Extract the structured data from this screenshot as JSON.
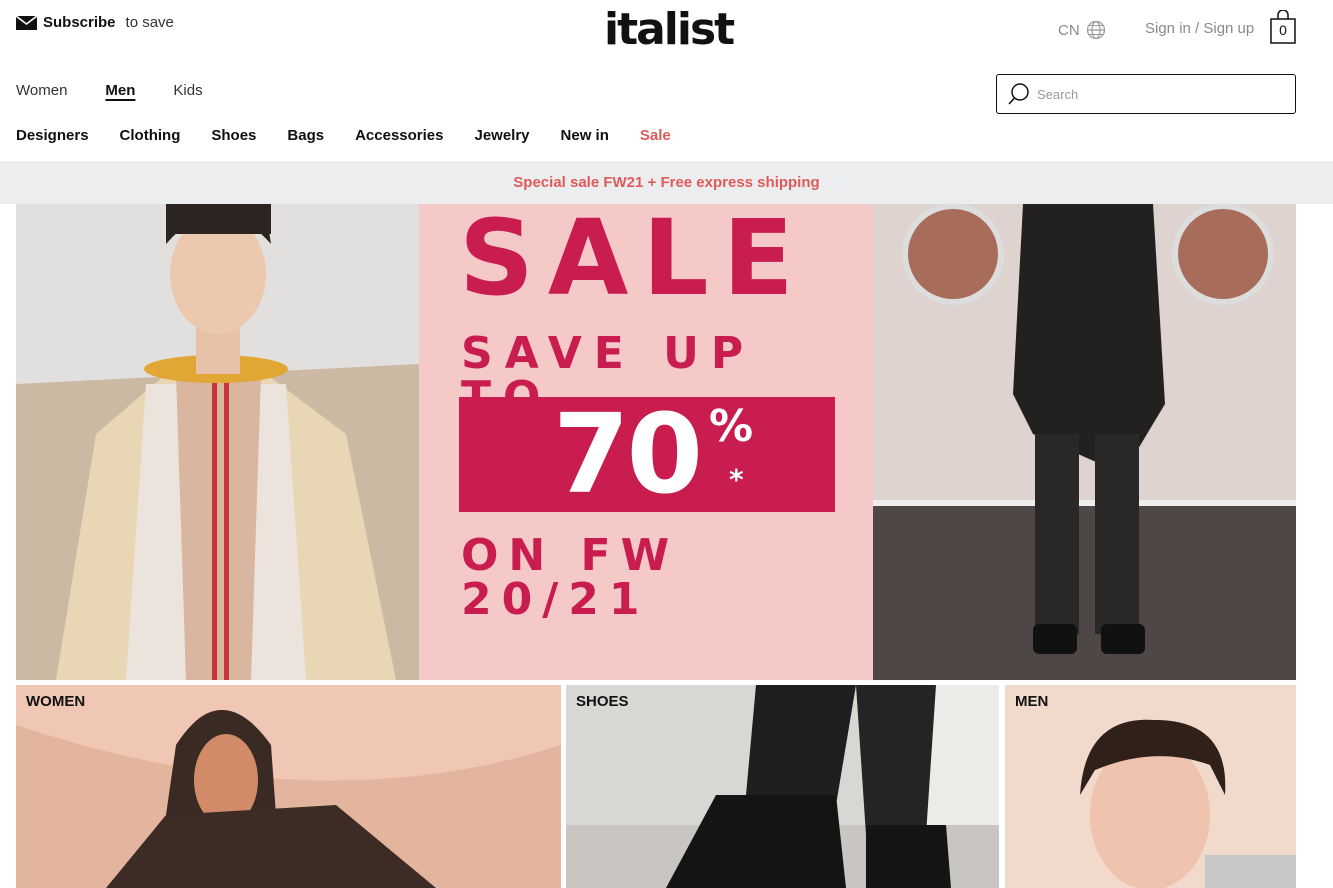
{
  "header": {
    "subscribe_bold": "Subscribe",
    "subscribe_rest": "to save",
    "logo": "italist",
    "locale": "CN",
    "signin": "Sign in / Sign up",
    "cart_count": "0"
  },
  "gender_nav": [
    {
      "label": "Women",
      "active": false
    },
    {
      "label": "Men",
      "active": true
    },
    {
      "label": "Kids",
      "active": false
    }
  ],
  "search": {
    "placeholder": "Search",
    "value": ""
  },
  "categories": [
    "Designers",
    "Clothing",
    "Shoes",
    "Bags",
    "Accessories",
    "Jewelry",
    "New in",
    "Sale"
  ],
  "promo_bar": "Special sale FW21 + Free express shipping",
  "hero": {
    "headline": "SALE",
    "line2": "SAVE UP TO",
    "percent": "70",
    "percent_sign": "%",
    "asterisk": "*",
    "line4": "ON FW 20/21"
  },
  "tiles": [
    {
      "label": "WOMEN"
    },
    {
      "label": "SHOES"
    },
    {
      "label": "MEN"
    }
  ],
  "colors": {
    "sale_accent": "#c81d4e",
    "sale_nav": "#e05a5a",
    "promo_bg": "#ecedef",
    "hero_pink": "#f6c9c9"
  }
}
